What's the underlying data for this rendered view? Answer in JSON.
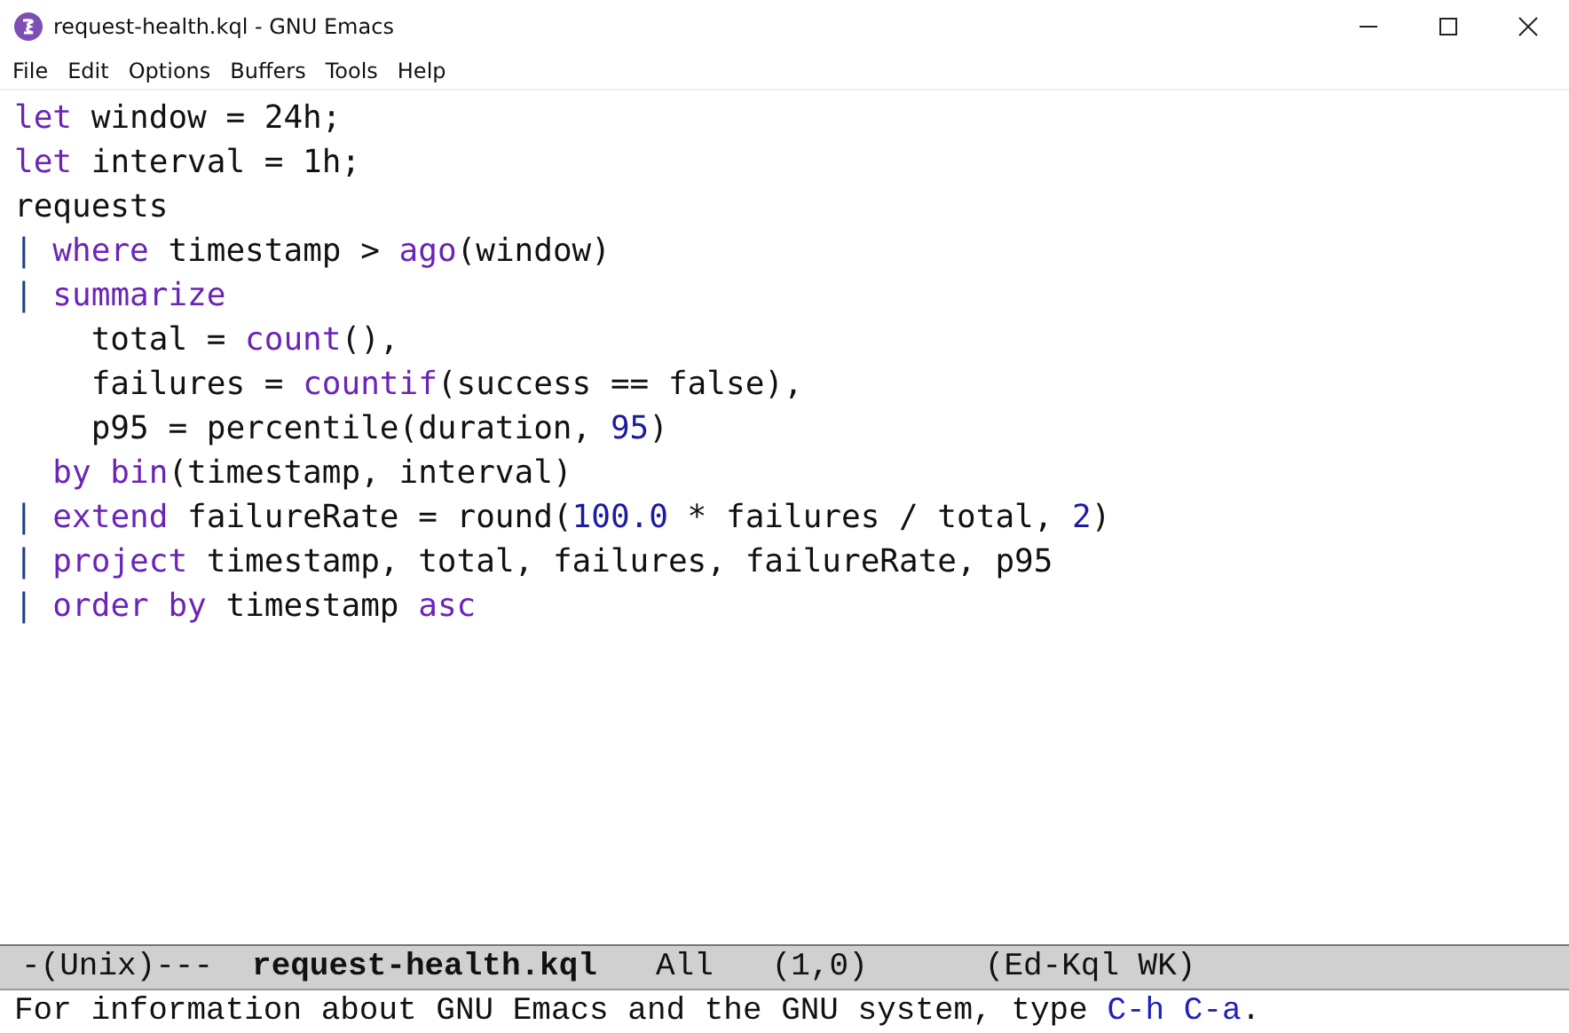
{
  "window": {
    "title": "request-health.kql - GNU Emacs"
  },
  "menu": [
    "File",
    "Edit",
    "Options",
    "Buffers",
    "Tools",
    "Help"
  ],
  "code_lines": [
    [
      {
        "text": "let",
        "kind": "keyword"
      },
      {
        "text": " window = 24h;",
        "kind": "plain"
      }
    ],
    [
      {
        "text": "let",
        "kind": "keyword"
      },
      {
        "text": " interval = 1h;",
        "kind": "plain"
      }
    ],
    [
      {
        "text": "requests",
        "kind": "plain"
      }
    ],
    [
      {
        "text": "|",
        "kind": "pipe"
      },
      {
        "text": " where",
        "kind": "keyword"
      },
      {
        "text": " timestamp > ",
        "kind": "plain"
      },
      {
        "text": "ago",
        "kind": "keyword"
      },
      {
        "text": "(window)",
        "kind": "plain"
      }
    ],
    [
      {
        "text": "|",
        "kind": "pipe"
      },
      {
        "text": " summarize",
        "kind": "keyword"
      }
    ],
    [
      {
        "text": "    total = ",
        "kind": "plain"
      },
      {
        "text": "count",
        "kind": "keyword"
      },
      {
        "text": "(),",
        "kind": "plain"
      }
    ],
    [
      {
        "text": "    failures = ",
        "kind": "plain"
      },
      {
        "text": "countif",
        "kind": "keyword"
      },
      {
        "text": "(success == false),",
        "kind": "plain"
      }
    ],
    [
      {
        "text": "    p95 = percentile(duration, ",
        "kind": "plain"
      },
      {
        "text": "95",
        "kind": "number"
      },
      {
        "text": ")",
        "kind": "plain"
      }
    ],
    [
      {
        "text": "  by bin",
        "kind": "keyword"
      },
      {
        "text": "(timestamp, interval)",
        "kind": "plain"
      }
    ],
    [
      {
        "text": "|",
        "kind": "pipe"
      },
      {
        "text": " extend",
        "kind": "keyword"
      },
      {
        "text": " failureRate = round(",
        "kind": "plain"
      },
      {
        "text": "100.0",
        "kind": "number"
      },
      {
        "text": " * failures / total, ",
        "kind": "plain"
      },
      {
        "text": "2",
        "kind": "number"
      },
      {
        "text": ")",
        "kind": "plain"
      }
    ],
    [
      {
        "text": "|",
        "kind": "pipe"
      },
      {
        "text": " project",
        "kind": "keyword"
      },
      {
        "text": " timestamp, total, failures, failureRate, p95",
        "kind": "plain"
      }
    ],
    [
      {
        "text": "|",
        "kind": "pipe"
      },
      {
        "text": " order by",
        "kind": "keyword"
      },
      {
        "text": " timestamp ",
        "kind": "plain"
      },
      {
        "text": "asc",
        "kind": "keyword"
      }
    ]
  ],
  "mode_line": {
    "status": "-(Unix)---",
    "buffer": "request-health.kql",
    "position": "All",
    "cursor": "(1,0)",
    "modes": "(Ed-Kql WK)"
  },
  "echo_area": [
    {
      "text": "For information about GNU Emacs and the GNU system, type ",
      "kind": "plain"
    },
    {
      "text": "C-h C-a",
      "kind": "key"
    },
    {
      "text": ".",
      "kind": "plain"
    }
  ]
}
